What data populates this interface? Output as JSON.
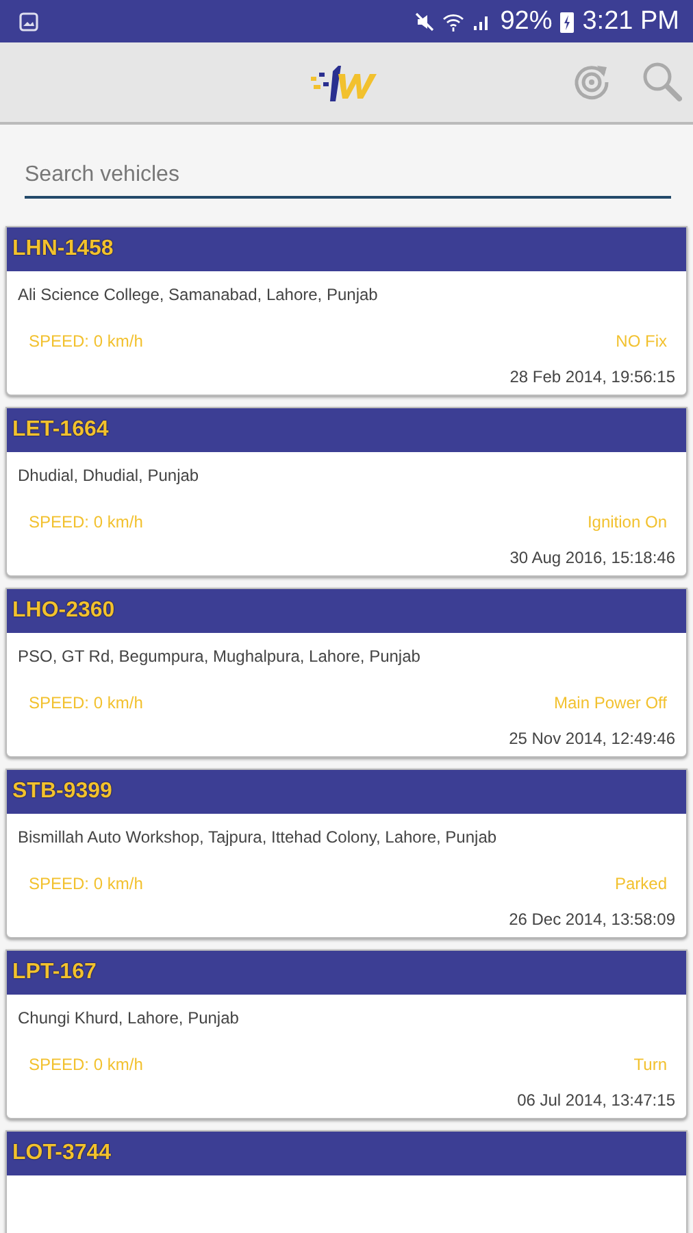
{
  "status_bar": {
    "battery": "92%",
    "time": "3:21 PM"
  },
  "search": {
    "placeholder": "Search vehicles"
  },
  "vehicles": [
    {
      "plate": "LHN-1458",
      "address": "Ali Science College, Samanabad, Lahore, Punjab",
      "speed": "SPEED: 0 km/h",
      "status": "NO Fix",
      "timestamp": "28 Feb 2014, 19:56:15"
    },
    {
      "plate": "LET-1664",
      "address": "Dhudial, Dhudial, Punjab",
      "speed": "SPEED: 0 km/h",
      "status": "Ignition On",
      "timestamp": "30 Aug 2016, 15:18:46"
    },
    {
      "plate": "LHO-2360",
      "address": "PSO, GT Rd, Begumpura, Mughalpura, Lahore, Punjab",
      "speed": "SPEED: 0 km/h",
      "status": "Main Power Off",
      "timestamp": "25 Nov 2014, 12:49:46"
    },
    {
      "plate": "STB-9399",
      "address": "Bismillah Auto Workshop, Tajpura, Ittehad Colony, Lahore, Punjab",
      "speed": "SPEED: 0 km/h",
      "status": "Parked",
      "timestamp": "26 Dec 2014, 13:58:09"
    },
    {
      "plate": "LPT-167",
      "address": "Chungi Khurd, Lahore, Punjab",
      "speed": "SPEED: 0 km/h",
      "status": "Turn",
      "timestamp": "06 Jul 2014, 13:47:15"
    },
    {
      "plate": "LOT-3744"
    }
  ]
}
